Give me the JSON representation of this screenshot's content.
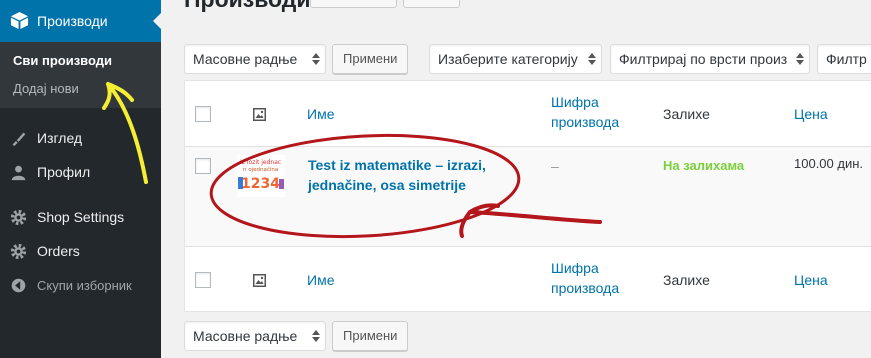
{
  "sidebar": {
    "products_label": "Производи",
    "submenu": {
      "all_products": "Сви производи",
      "add_new": "Додај нови"
    },
    "items": [
      {
        "label": "Изглед",
        "icon": "paintbrush-icon"
      },
      {
        "label": "Профил",
        "icon": "user-icon"
      },
      {
        "label": "Shop Settings",
        "icon": "gear-icon"
      },
      {
        "label": "Orders",
        "icon": "gear-icon"
      },
      {
        "label": "Скупи изборник",
        "icon": "collapse-icon"
      }
    ]
  },
  "page": {
    "title": "Производи"
  },
  "toolbar_top": {
    "bulk_actions": "Масовне радње",
    "apply": "Примени",
    "category_filter": "Изаберите категорију",
    "type_filter": "Филтрирај по врсти произ",
    "stock_filter": "Филтр"
  },
  "table": {
    "headers": {
      "name": "Име",
      "sku": "Шифра производа",
      "stock": "Залихе",
      "price": "Цена"
    },
    "rows": [
      {
        "name": "Test iz matematike – izrazi, jednačine, osa simetrije",
        "sku": "–",
        "stock": "На залихама",
        "price": "100.00 дин."
      }
    ],
    "thumb_text": [
      "Iz lozit jednac",
      "n ojednačina",
      "1234"
    ]
  },
  "toolbar_bottom": {
    "bulk_actions": "Масовне радње",
    "apply": "Примени"
  },
  "colors": {
    "accent": "#0073aa",
    "sidebar": "#23282d",
    "in_stock": "#7ad03a",
    "annotation_red": "#b3161b",
    "annotation_yellow": "#f6ee32"
  }
}
